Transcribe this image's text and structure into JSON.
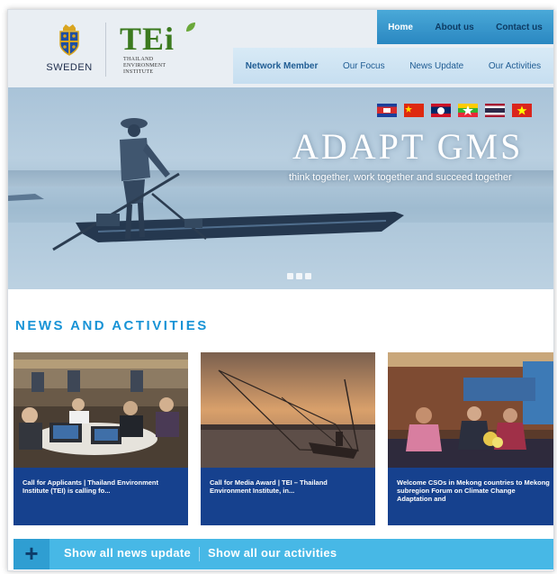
{
  "logos": {
    "sweden": "SWEDEN",
    "tei_word": "TEi",
    "tei_sub": [
      "THAILAND",
      "ENVIRONMENT",
      "INSTITUTE"
    ]
  },
  "topnav": [
    "Home",
    "About us",
    "Contact us"
  ],
  "mainnav": [
    "Network Member",
    "Our Focus",
    "News Update",
    "Our Activities"
  ],
  "hero": {
    "title": "ADAPT GMS",
    "subtitle": "think together, work together and succeed together",
    "flags": [
      "cambodia-flag",
      "china-flag",
      "laos-flag",
      "myanmar-flag",
      "thailand-flag",
      "vietnam-flag"
    ]
  },
  "news": {
    "heading": "NEWS AND ACTIVITIES",
    "cards": [
      {
        "caption": "Call for Applicants | Thailand Environment Institute (TEI) is calling fo..."
      },
      {
        "caption": "Call for Media Award | TEI – Thailand Environment Institute, in..."
      },
      {
        "caption": "Welcome CSOs in Mekong countries to Mekong subregion Forum on Climate Change Adaptation and"
      }
    ]
  },
  "bottombar": {
    "plus": "+",
    "link1": "Show all news update",
    "link2": "Show all our activities"
  },
  "colors": {
    "accent": "#1893d6",
    "card_bg": "#16418e",
    "bar_bg": "#47b8e6",
    "tei_green": "#3c7a1f"
  }
}
